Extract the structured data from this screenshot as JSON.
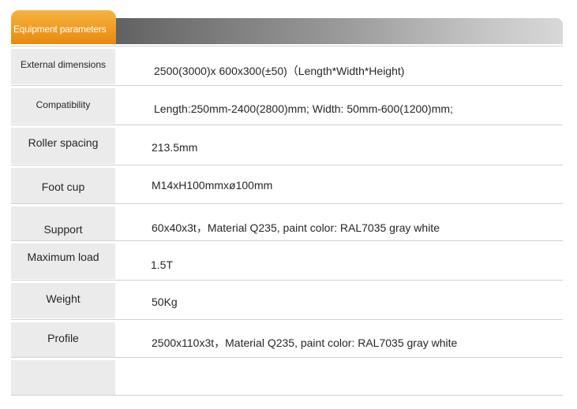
{
  "header": {
    "title": "Equipment parameters"
  },
  "rows": [
    {
      "label": "External dimensions",
      "value": "2500(3000)x 600x300(±50)（Length*Width*Height)"
    },
    {
      "label": "Compatibility",
      "value": "Length:250mm-2400(2800)mm;  Width:  50mm-600(1200)mm;"
    },
    {
      "label": "Roller spacing",
      "value": "213.5mm"
    },
    {
      "label": "Foot cup",
      "value": "M14xH100mmxø100mm"
    },
    {
      "label": "Support",
      "value": "60x40x3t，Material Q235, paint color: RAL7035 gray white"
    },
    {
      "label": "Maximum load",
      "value": "1.5T"
    },
    {
      "label": "Weight",
      "value": "50Kg"
    },
    {
      "label": "Profile",
      "value": "2500x110x3t，Material Q235, paint color: RAL7035 gray white"
    },
    {
      "label": "",
      "value": ""
    }
  ]
}
